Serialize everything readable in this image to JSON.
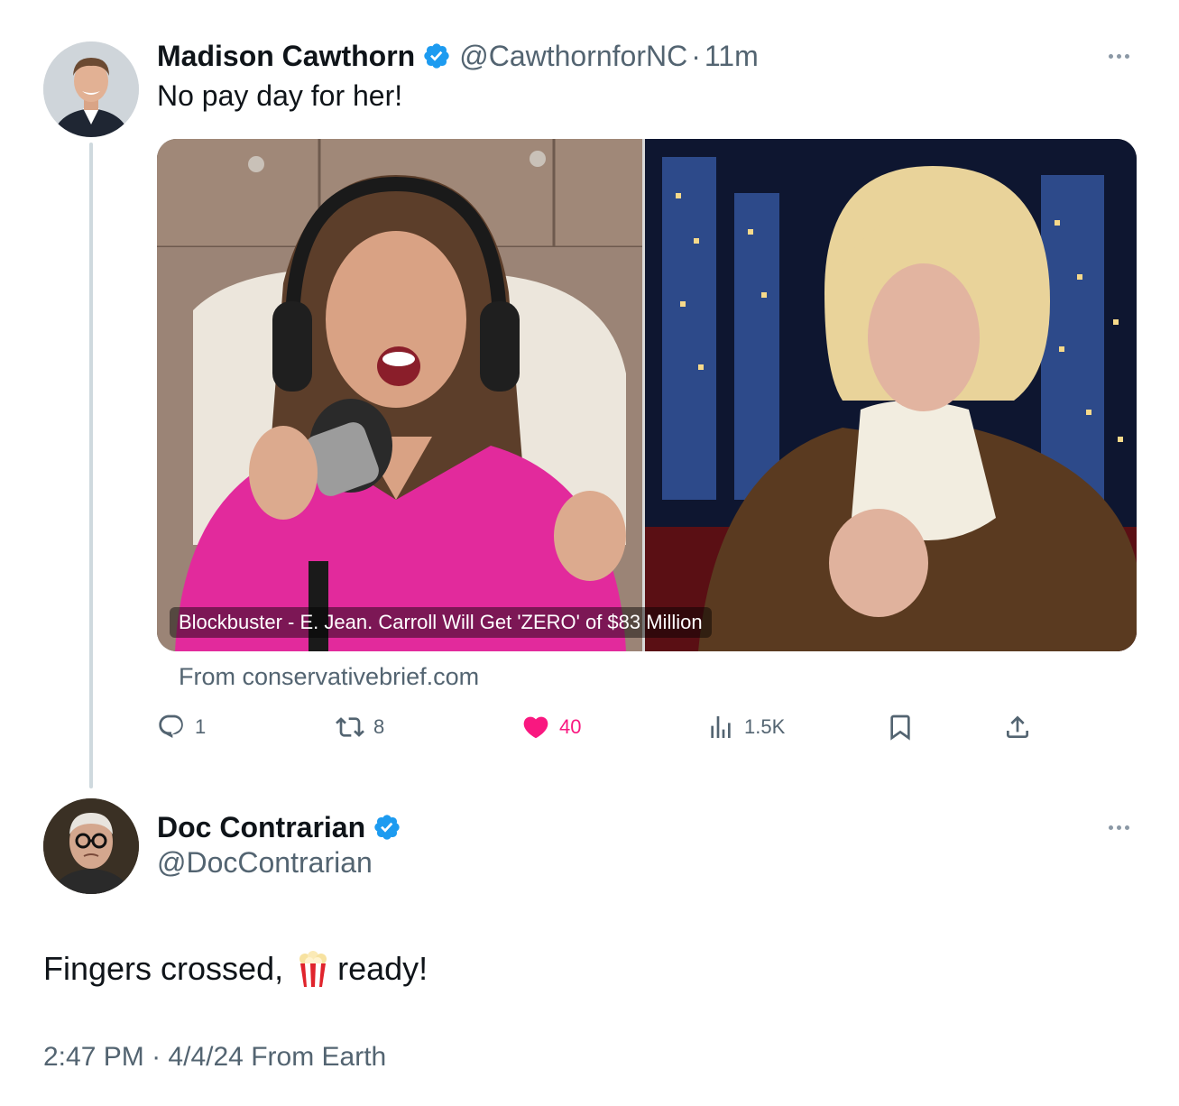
{
  "tweet": {
    "display_name": "Madison Cawthorn",
    "handle": "@CawthornforNC",
    "separator": "·",
    "time": "11m",
    "text": "No pay day for her!",
    "card": {
      "caption": "Blockbuster - E. Jean. Carroll Will Get 'ZERO' of $83 Million",
      "source": "From conservativebrief.com"
    },
    "actions": {
      "replies": "1",
      "retweets": "8",
      "likes": "40",
      "views": "1.5K"
    }
  },
  "reply": {
    "display_name": "Doc Contrarian",
    "handle": "@DocContrarian",
    "text_before": "Fingers crossed,",
    "text_after": "ready!",
    "emoji_icon": "popcorn-icon",
    "timestamp": "2:47 PM",
    "separator": "·",
    "date": "4/4/24",
    "source": "From Earth"
  },
  "colors": {
    "verified": "#1d9bf0",
    "like": "#f91880",
    "secondary_text": "#536471",
    "thread_line": "#cfd9de"
  }
}
